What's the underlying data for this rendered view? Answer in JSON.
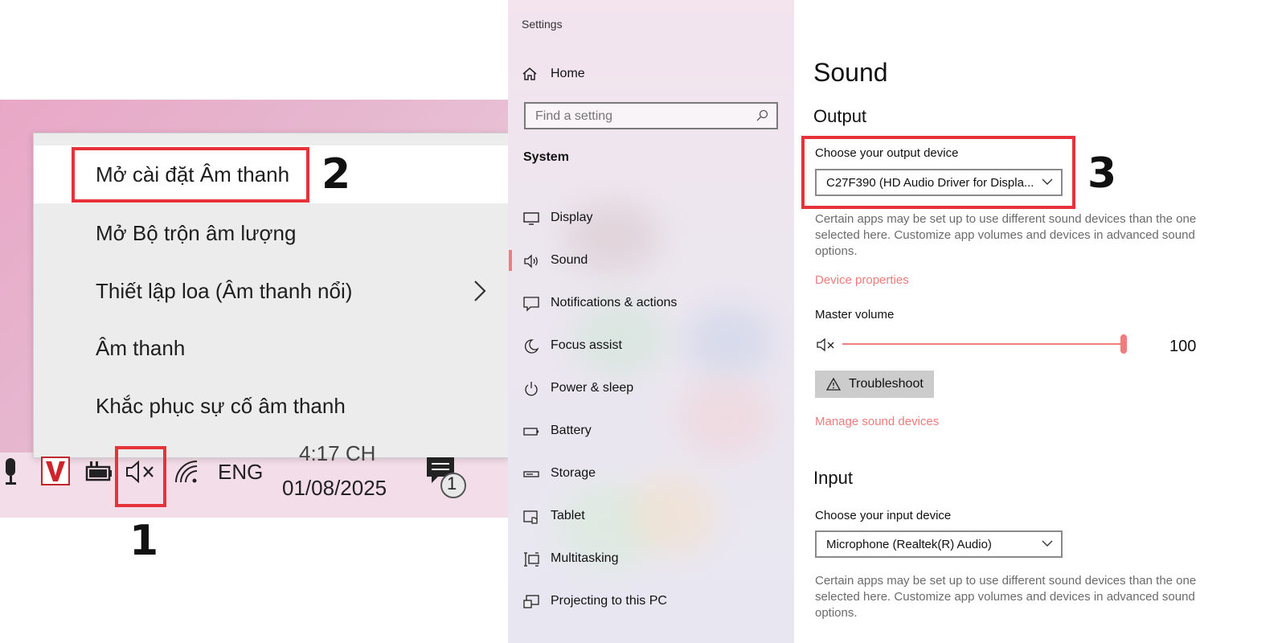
{
  "context_menu": {
    "items": [
      {
        "label": "Mở cài đặt Âm thanh"
      },
      {
        "label": "Mở Bộ trộn âm lượng"
      },
      {
        "label": "Thiết lập loa (Âm thanh nổi)"
      },
      {
        "label": "Âm thanh"
      },
      {
        "label": "Khắc phục sự cố âm thanh"
      }
    ]
  },
  "taskbar": {
    "language": "ENG",
    "time": "4:17 CH",
    "date": "01/08/2025",
    "notification_count": "1"
  },
  "steps": {
    "one": "1",
    "two": "2",
    "three": "3"
  },
  "settings": {
    "window_title": "Settings",
    "home_label": "Home",
    "search_placeholder": "Find a setting",
    "section_label": "System",
    "nav": [
      {
        "label": "Display",
        "icon": "display-icon"
      },
      {
        "label": "Sound",
        "icon": "speaker-icon"
      },
      {
        "label": "Notifications & actions",
        "icon": "notifications-icon"
      },
      {
        "label": "Focus assist",
        "icon": "moon-icon"
      },
      {
        "label": "Power & sleep",
        "icon": "power-icon"
      },
      {
        "label": "Battery",
        "icon": "battery-icon"
      },
      {
        "label": "Storage",
        "icon": "storage-icon"
      },
      {
        "label": "Tablet",
        "icon": "tablet-icon"
      },
      {
        "label": "Multitasking",
        "icon": "multitasking-icon"
      },
      {
        "label": "Projecting to this PC",
        "icon": "projecting-icon"
      }
    ],
    "page_title": "Sound",
    "output": {
      "heading": "Output",
      "device_label": "Choose your output device",
      "device_value": "C27F390 (HD Audio Driver for Displa...",
      "help": "Certain apps may be set up to use different sound devices than the one selected here. Customize app volumes and devices in advanced sound options.",
      "device_properties_link": "Device properties",
      "master_volume_label": "Master volume",
      "volume_value": "100",
      "volume_level": 1.0,
      "troubleshoot_label": "Troubleshoot",
      "manage_link": "Manage sound devices"
    },
    "input": {
      "heading": "Input",
      "device_label": "Choose your input device",
      "device_value": "Microphone (Realtek(R) Audio)",
      "help": "Certain apps may be set up to use different sound devices than the one selected here. Customize app volumes and devices in advanced sound options."
    },
    "accent_color": "#f27b7b"
  }
}
